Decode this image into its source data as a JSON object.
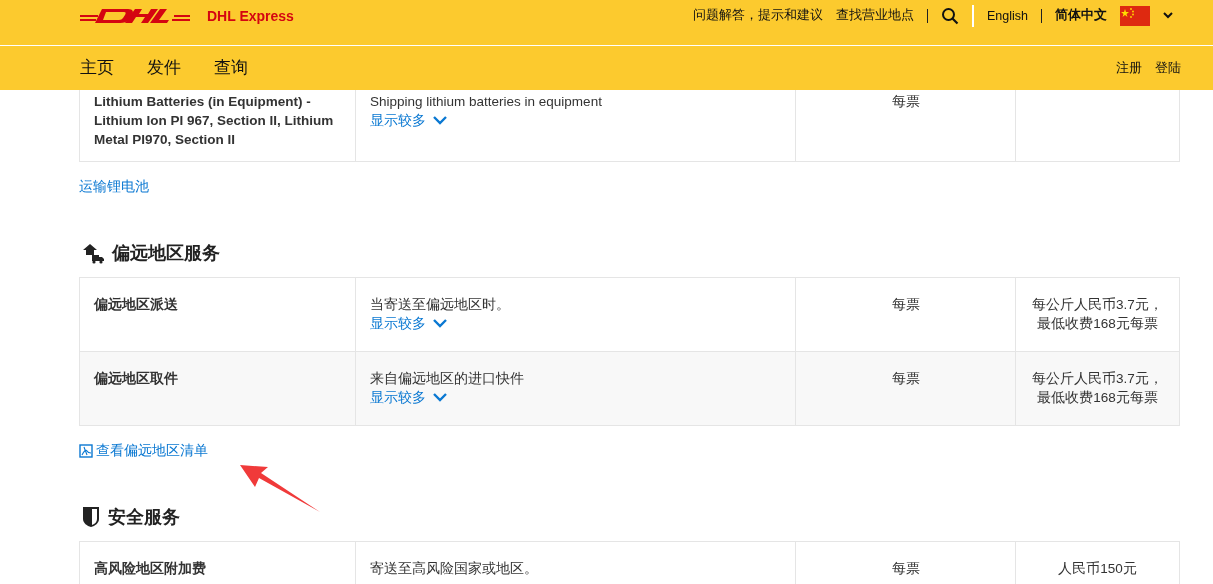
{
  "header": {
    "logo_text": "DHL Express",
    "top_links": [
      "问题解答，提示和建议",
      "查找营业地点"
    ],
    "languages": [
      {
        "label": "English",
        "selected": false
      },
      {
        "label": "简体中文",
        "selected": true
      }
    ],
    "nav": [
      "主页",
      "发件",
      "查询"
    ],
    "account_links": [
      "注册",
      "登陆"
    ]
  },
  "sections": [
    {
      "rows": [
        {
          "name": "Lithium Batteries (in Equipment) - Lithium Ion PI 967, Section II, Lithium Metal PI970, Section II",
          "description": "Shipping lithium batteries in equipment",
          "show_more": "显示较多",
          "unit": "每票"
        }
      ],
      "link": {
        "text": "运输锂电池"
      }
    },
    {
      "title": "偏远地区服务",
      "kind": "remote",
      "rows": [
        {
          "name": "偏远地区派送",
          "description": "当寄送至偏远地区时。",
          "show_more": "显示较多",
          "unit": "每票",
          "price": [
            "每公斤人民币3.7元，",
            "最低收费168元每票"
          ]
        },
        {
          "name": "偏远地区取件",
          "description": "来自偏远地区的进口快件",
          "show_more": "显示较多",
          "unit": "每票",
          "price": [
            "每公斤人民币3.7元，",
            "最低收费168元每票"
          ]
        }
      ],
      "link": {
        "text": "查看偏远地区清单",
        "document": true
      }
    },
    {
      "title": "安全服务",
      "kind": "shield",
      "rows": [
        {
          "name": "高风险地区附加费",
          "description": "寄送至高风险国家或地区。",
          "unit": "每票",
          "price": [
            "人民币150元"
          ]
        }
      ]
    }
  ]
}
